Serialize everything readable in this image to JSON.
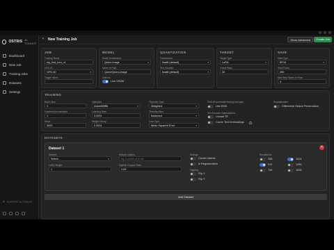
{
  "app": {
    "brand": "OSTRIS",
    "brand_sub": "AI-TOOLKIT"
  },
  "nav": [
    {
      "label": "Dashboard",
      "icon": "grid-icon"
    },
    {
      "label": "New Job",
      "icon": "plus-icon"
    },
    {
      "label": "Training Jobs",
      "icon": "list-icon"
    },
    {
      "label": "Datasets",
      "icon": "folder-icon"
    },
    {
      "label": "Settings",
      "icon": "gear-icon"
    }
  ],
  "sidebar_footer": "SUPPORT AI-TOOLKIT",
  "header": {
    "back": "‹",
    "title": "New Training Job",
    "show_advanced": "Show Advanced",
    "create_job": "Create Job"
  },
  "job": {
    "heading": "JOB",
    "training_name_label": "Training Name",
    "training_name": "my_first_lora_v1",
    "gpu_id_label": "GPU ID",
    "gpu_id": "GPU #0",
    "trigger_word_label": "Trigger Word"
  },
  "model": {
    "heading": "MODEL",
    "arch_label": "Model Architecture",
    "arch": "Qwen-Image",
    "path_label": "Name or Path",
    "path": "Qwen/Qwen-Image",
    "options_label": "Options",
    "low_vram": "Low VRAM"
  },
  "quant": {
    "heading": "QUANTIZATION",
    "transformer_label": "Transformer",
    "transformer": "float8 (default)",
    "text_encoder_label": "Text Encoder",
    "text_encoder": "float8 (default)"
  },
  "target": {
    "heading": "TARGET",
    "type_label": "Target Type",
    "type": "LoRA",
    "rank_label": "Linear Rank",
    "rank": "32"
  },
  "save": {
    "heading": "SAVE",
    "dtype_label": "Data Type",
    "dtype": "BF16",
    "every_label": "Save Every",
    "every": "250",
    "max_label": "Max Step Saves to Keep",
    "max": "4"
  },
  "training": {
    "heading": "TRAINING",
    "batch_label": "Batch Size",
    "batch": "1",
    "grad_label": "Gradient Accumulation",
    "grad": "1",
    "steps_label": "Steps",
    "steps": "3000",
    "optim_label": "Optimizer",
    "optim": "AdamW8Bit",
    "lr_label": "Learning Rate",
    "lr": "0.0001",
    "wd_label": "Weight Decay",
    "wd": "0.0001",
    "ts_type_label": "Timestep Type",
    "ts_type": "Weighted",
    "ts_bias_label": "Timestep Bias",
    "ts_bias": "Balanced",
    "loss_label": "Loss Type",
    "loss": "Mean Squared Error",
    "ema_label": "EMA (Exponential Moving Average)",
    "ema": "Use EMA",
    "te_opt_label": "Text Encoder Optimizations",
    "unload_te": "Unload TE",
    "cache_te": "Cache Text Embeddings",
    "reg_label": "Regularization",
    "diff_out": "Differential Output Preservation"
  },
  "datasets": {
    "heading": "DATASETS",
    "card_title": "Dataset 1",
    "dataset_label": "Dataset",
    "dataset": "Select...",
    "lora_weight_label": "LoRA Weight",
    "lora_weight": "1",
    "caption_label": "Default Caption",
    "caption_placeholder": "eg. A photo of a cat",
    "caption_dropout_label": "Caption Dropout Rate",
    "caption_dropout": "0.05",
    "settings_label": "Settings",
    "cache_latents": "Cache Latents",
    "is_reg": "Is Regularization",
    "flipping_label": "Flipping",
    "flip_x": "Flip X",
    "flip_y": "Flip Y",
    "res_label": "Resolutions",
    "resolutions": [
      {
        "label": "256",
        "on": false
      },
      {
        "label": "512",
        "on": true
      },
      {
        "label": "768",
        "on": false
      },
      {
        "label": "1024",
        "on": true
      },
      {
        "label": "1280",
        "on": false
      },
      {
        "label": "1536",
        "on": false
      }
    ],
    "add": "Add Dataset"
  }
}
